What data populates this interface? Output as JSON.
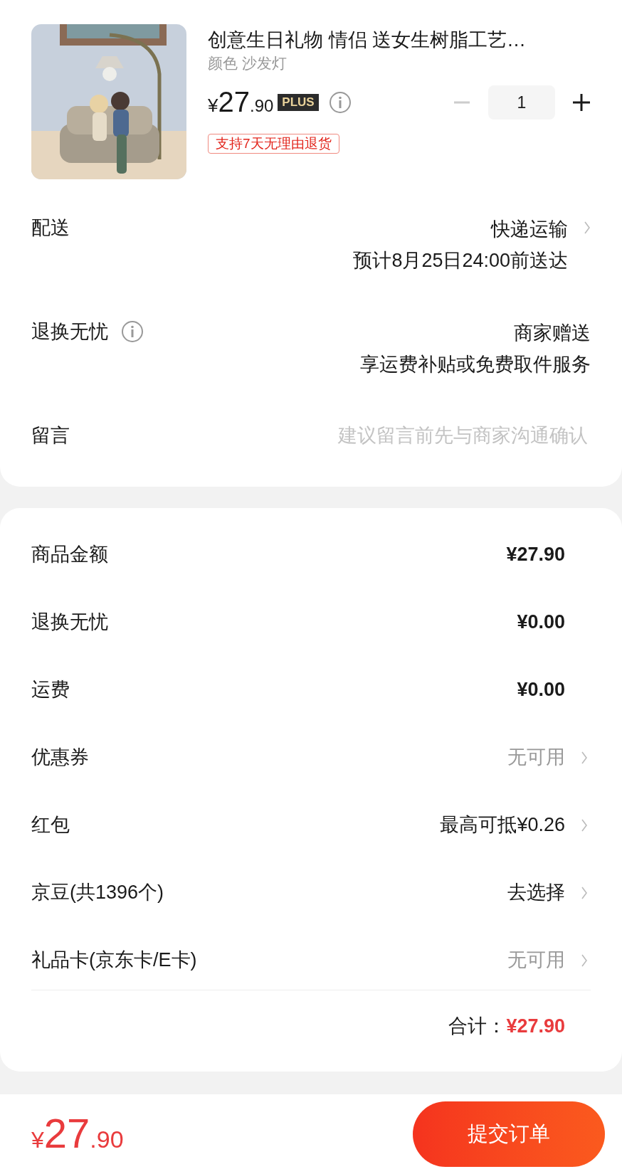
{
  "product": {
    "kind": "picture",
    "title": "创意生日礼物 情侣 送女生树脂工艺…",
    "variant": "颜色 沙发灯",
    "price": {
      "currency": "¥",
      "integer": "27",
      "decimal": ".90"
    },
    "badge": "PLUS",
    "quantity": {
      "value": "1",
      "minus_disabled": true
    },
    "tag": "支持7天无理由退货"
  },
  "info_rows": [
    {
      "label": "配送",
      "info_icon": false,
      "lines": [
        "快递运输",
        "预计8月25日24:00前送达"
      ],
      "arrow": true,
      "kind": "text"
    },
    {
      "label": "退换无忧",
      "info_icon": true,
      "lines": [
        "商家赠送",
        "享运费补贴或免费取件服务"
      ],
      "arrow": false,
      "kind": "text"
    },
    {
      "label": "留言",
      "info_icon": false,
      "placeholder": "建议留言前先与商家沟通确认",
      "arrow": false,
      "kind": "field"
    }
  ],
  "summary_rows": [
    {
      "label": "商品金额",
      "value": "¥27.90",
      "kind": "amount",
      "arrow": false
    },
    {
      "label": "退换无忧",
      "value": "¥0.00",
      "kind": "amount",
      "arrow": false
    },
    {
      "label": "运费",
      "value": "¥0.00",
      "kind": "amount",
      "arrow": false
    },
    {
      "label": "优惠券",
      "value": "无可用",
      "kind": "unavailable",
      "arrow": true
    },
    {
      "label": "红包",
      "value": "最高可抵¥0.26",
      "kind": "option",
      "arrow": true
    },
    {
      "label": "京豆(共1396个)",
      "value": "去选择",
      "kind": "option",
      "arrow": true
    },
    {
      "label": "礼品卡(京东卡/E卡)",
      "value": "无可用",
      "kind": "unavailable",
      "arrow": true
    }
  ],
  "total": {
    "label": "合计：",
    "value": "¥27.90"
  },
  "footer": {
    "price": {
      "currency": "¥",
      "integer": "27",
      "decimal": ".90"
    },
    "button": "提交订单"
  }
}
